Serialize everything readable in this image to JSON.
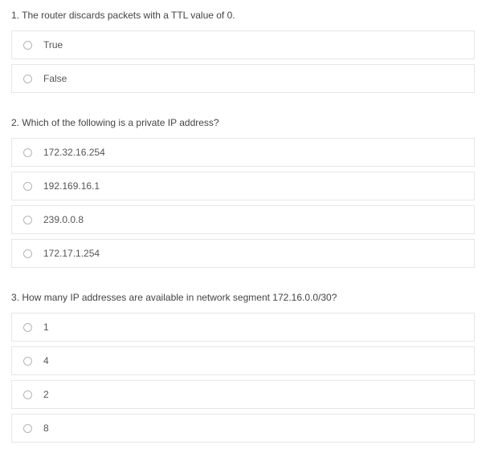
{
  "questions": [
    {
      "number": "1.",
      "prompt": "The router discards packets with a TTL value of 0.",
      "options": [
        "True",
        "False"
      ]
    },
    {
      "number": "2.",
      "prompt": "Which of the following is a private IP address?",
      "options": [
        "172.32.16.254",
        "192.169.16.1",
        "239.0.0.8",
        "172.17.1.254"
      ]
    },
    {
      "number": "3.",
      "prompt": "How many IP addresses are available in network segment 172.16.0.0/30?",
      "options": [
        "1",
        "4",
        "2",
        "8"
      ]
    }
  ]
}
